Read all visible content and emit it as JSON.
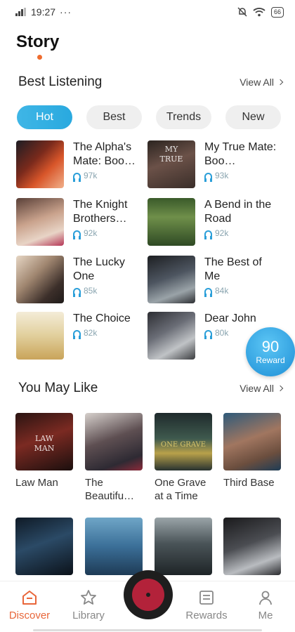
{
  "status": {
    "time": "19:27",
    "battery": "66"
  },
  "header": {
    "title": "Story"
  },
  "best_listening": {
    "title": "Best Listening",
    "view_all": "View All",
    "tabs": [
      "Hot",
      "Best",
      "Trends",
      "New"
    ],
    "books": [
      {
        "title": "The Alpha's Mate: Boo…",
        "listens": "97k"
      },
      {
        "title": "My True Mate: Boo…",
        "listens": "93k"
      },
      {
        "title": "The Knight Brothers…",
        "listens": "92k"
      },
      {
        "title": "A Bend in the Road",
        "listens": "92k"
      },
      {
        "title": "The Lucky One",
        "listens": "85k"
      },
      {
        "title": "The Best of Me",
        "listens": "84k"
      },
      {
        "title": "The Choice",
        "listens": "82k"
      },
      {
        "title": "Dear John",
        "listens": "80k"
      }
    ]
  },
  "reward": {
    "value": "90",
    "label": "Reward"
  },
  "you_may_like": {
    "title": "You May Like",
    "view_all": "View All",
    "books": [
      {
        "title": "Law Man"
      },
      {
        "title": "The Beautifu…"
      },
      {
        "title": "One Grave at a Time"
      },
      {
        "title": "Third Base"
      }
    ]
  },
  "nav": {
    "items": [
      {
        "label": "Discover",
        "icon": "home-icon"
      },
      {
        "label": "Library",
        "icon": "star-icon"
      },
      {
        "label": "Rewards",
        "icon": "rewards-icon"
      },
      {
        "label": "Me",
        "icon": "profile-icon"
      }
    ],
    "active": "Discover"
  },
  "colors": {
    "accent": "#e8663a",
    "primary": "#29a9df"
  }
}
